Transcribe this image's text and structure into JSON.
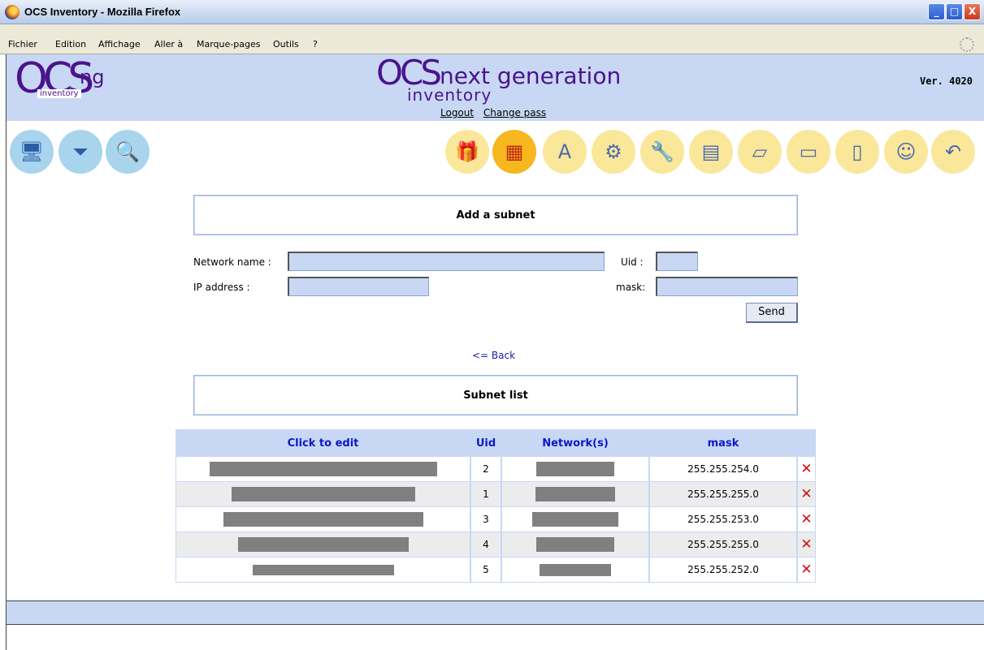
{
  "window": {
    "title": "OCS Inventory - Mozilla Firefox",
    "buttons": [
      "_",
      "□",
      "X"
    ]
  },
  "menu": [
    "Fichier",
    "Edition",
    "Affichage",
    "Aller à",
    "Marque-pages",
    "Outils",
    "?"
  ],
  "header": {
    "logo_left": {
      "ocs": "OCS",
      "ng": "ng",
      "inventory": "inventory"
    },
    "logo_center": {
      "ocs": "OCS",
      "next": "next generation",
      "inventory": "inventory"
    },
    "links": [
      "Logout",
      "Change pass"
    ],
    "version": "Ver. 4020"
  },
  "left_icons": [
    "computers-icon",
    "filter-icon",
    "search-icon"
  ],
  "right_icons": [
    "packages-icon",
    "firewall-icon",
    "dictionary-icon",
    "gears-icon",
    "wrench-icon",
    "registry-icon",
    "documents-icon",
    "wallet-icon",
    "notepad-icon",
    "help-icon",
    "back-icon"
  ],
  "add_subnet": {
    "title": "Add a subnet",
    "network_name_label": "Network name :",
    "uid_label": "Uid :",
    "ip_label": "IP address :",
    "mask_label": "mask:",
    "send_label": "Send"
  },
  "back_link": "<= Back",
  "subnet_list": {
    "title": "Subnet list",
    "columns": [
      "Click to edit",
      "Uid",
      "Network(s)",
      "mask"
    ],
    "rows": [
      {
        "uid": "2",
        "mask": "255.255.254.0"
      },
      {
        "uid": "1",
        "mask": "255.255.255.0"
      },
      {
        "uid": "3",
        "mask": "255.255.253.0"
      },
      {
        "uid": "4",
        "mask": "255.255.255.0"
      },
      {
        "uid": "5",
        "mask": "255.255.252.0"
      }
    ],
    "delete_glyph": "✕"
  }
}
